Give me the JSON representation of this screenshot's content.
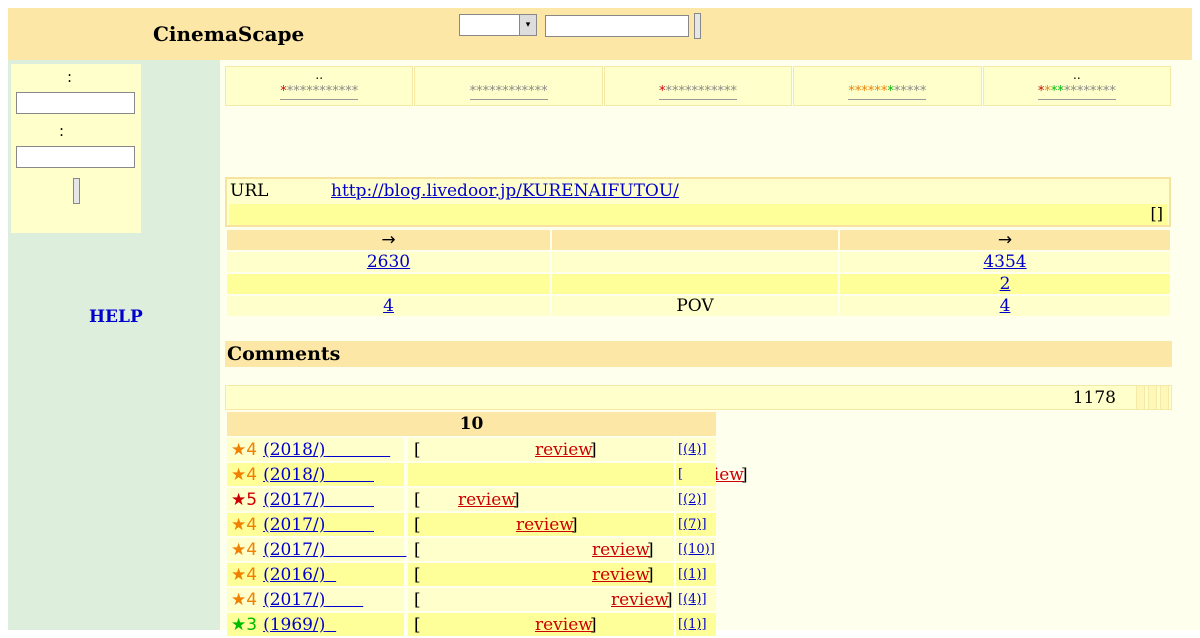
{
  "header": {
    "logo": "CinemaScape"
  },
  "login": {
    "label1": ":",
    "label2": ":"
  },
  "help": "HELP",
  "ratings": [
    {
      "top": "..",
      "stars": [
        [
          "r",
          "*"
        ],
        [
          "gr",
          "***********"
        ]
      ]
    },
    {
      "top": "",
      "stars": [
        [
          "gr",
          "************"
        ]
      ]
    },
    {
      "top": "",
      "stars": [
        [
          "r",
          "*"
        ],
        [
          "gr",
          "***********"
        ]
      ]
    },
    {
      "top": "",
      "stars": [
        [
          "o",
          "******"
        ],
        [
          "g",
          "*"
        ],
        [
          "gr",
          "*****"
        ]
      ]
    },
    {
      "top": "..",
      "stars": [
        [
          "r",
          "*"
        ],
        [
          "o",
          "*"
        ],
        [
          "g",
          "**"
        ],
        [
          "gr",
          "********"
        ]
      ]
    }
  ],
  "url": {
    "label": "URL",
    "link": "http://blog.livedoor.jp/KURENAIFUTOU/",
    "bracket": "[]"
  },
  "stats": {
    "header": [
      "→",
      "",
      "→"
    ],
    "rows": [
      [
        "2630",
        "",
        "4354"
      ],
      [
        "",
        "",
        "2"
      ],
      [
        "4",
        "POV",
        "4"
      ]
    ]
  },
  "comments": {
    "title": "Comments",
    "count": "1178",
    "head": "10",
    "rows": [
      {
        "star": "★",
        "star_color": "o",
        "score": "4",
        "title": "(2018/)",
        "ul_pad": "            ",
        "review": "review",
        "bracket_pos": "mid",
        "cnt": "[(4)]"
      },
      {
        "star": "★",
        "star_color": "o",
        "score": "4",
        "title": "(2018/)",
        "ul_pad": "         ",
        "review": "review",
        "bracket_pos": "right",
        "cnt": "["
      },
      {
        "star": "★",
        "star_color": "r",
        "score": "5",
        "title": "(2017/)",
        "ul_pad": "         ",
        "review": "review",
        "bracket_pos": "left",
        "cnt": "[(2)]"
      },
      {
        "star": "★",
        "star_color": "o",
        "score": "4",
        "title": "(2017/)",
        "ul_pad": "         ",
        "review": "review",
        "bracket_pos": "mid2",
        "cnt": "[(7)]"
      },
      {
        "star": "★",
        "star_color": "o",
        "score": "4",
        "title": "(2017/)",
        "ul_pad": "               ",
        "review": "review",
        "bracket_pos": "far",
        "cnt": "[(10)]"
      },
      {
        "star": "★",
        "star_color": "o",
        "score": "4",
        "title": "(2016/)",
        "ul_pad": "  ",
        "review": "review",
        "bracket_pos": "far",
        "cnt": "[(1)]"
      },
      {
        "star": "★",
        "star_color": "o",
        "score": "4",
        "title": "(2017/)",
        "ul_pad": "       ",
        "review": "review",
        "bracket_pos": "far2",
        "cnt": "[(4)]"
      },
      {
        "star": "★",
        "star_color": "g",
        "score": "3",
        "title": "(1969/)",
        "ul_pad": "  ",
        "review": "review",
        "bracket_pos": "mid",
        "cnt": "[(1)]"
      }
    ]
  }
}
